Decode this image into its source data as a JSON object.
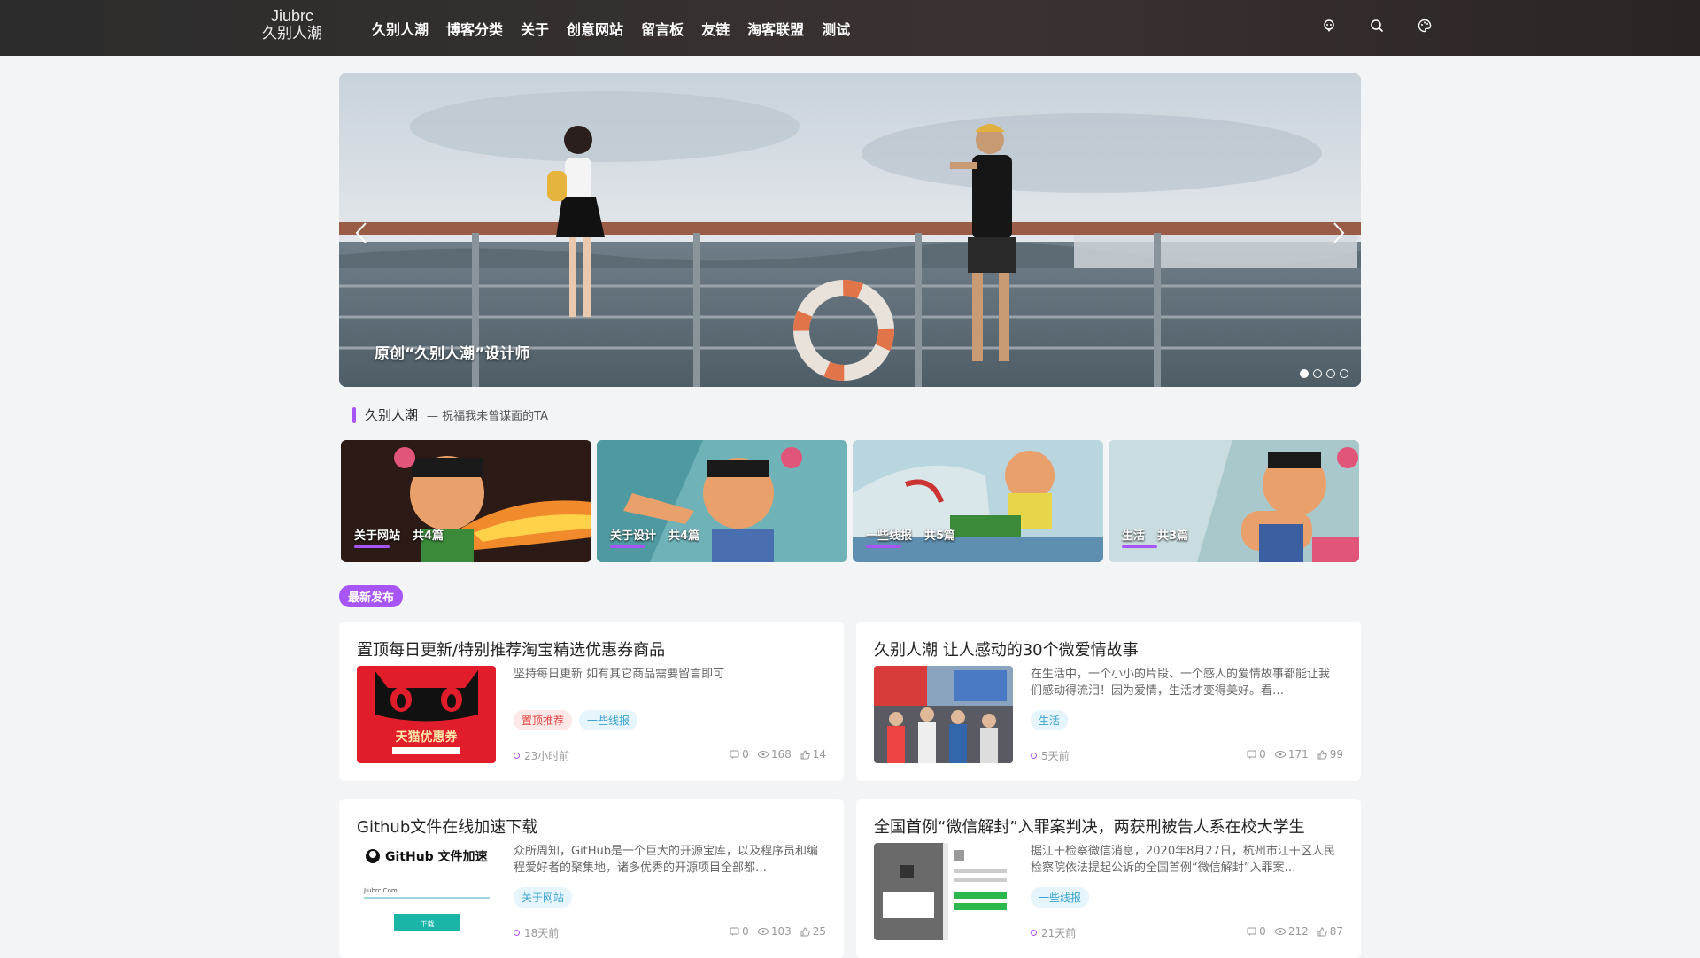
{
  "header": {
    "logo_en": "Jiubrc",
    "logo_cn": "久别人潮",
    "nav": [
      "久别人潮",
      "博客分类",
      "关于",
      "创意网站",
      "留言板",
      "友链",
      "淘客联盟",
      "测试"
    ],
    "icons": [
      "user-icon",
      "search-icon",
      "palette-icon"
    ]
  },
  "banner": {
    "caption": "原创“久别人潮”设计师",
    "slides": 4,
    "active_slide": 1
  },
  "section": {
    "title": "久别人潮",
    "subtitle": "— 祝福我未曾谋面的TA"
  },
  "categories": [
    {
      "name": "关于网站",
      "count": "共4篇"
    },
    {
      "name": "关于设计",
      "count": "共4篇"
    },
    {
      "name": "一些线报",
      "count": "共5篇"
    },
    {
      "name": "生活",
      "count": "共3篇"
    }
  ],
  "latest_badge": "最新发布",
  "posts": [
    {
      "title": "置顶每日更新/特别推荐淘宝精选优惠券商品",
      "desc": "坚持每日更新 如有其它商品需要留言即可",
      "tags": [
        {
          "text": "置顶推荐",
          "style": "red"
        },
        {
          "text": "一些线报",
          "style": "blue"
        }
      ],
      "time": "23小时前",
      "comments": "0",
      "views": "168",
      "likes": "14",
      "thumb_text": "天猫优惠券"
    },
    {
      "title": "久别人潮 让人感动的30个微爱情故事",
      "desc": "在生活中，一个小小的片段、一个感人的爱情故事都能让我们感动得流泪！因为爱情，生活才变得美好。看…",
      "tags": [
        {
          "text": "生活",
          "style": "blue"
        }
      ],
      "time": "5天前",
      "comments": "0",
      "views": "171",
      "likes": "99"
    },
    {
      "title": "Github文件在线加速下载",
      "desc": "众所周知，GitHub是一个巨大的开源宝库，以及程序员和编程爱好者的聚集地，诸多优秀的开源项目全部都…",
      "tags": [
        {
          "text": "关于网站",
          "style": "blue"
        }
      ],
      "time": "18天前",
      "comments": "0",
      "views": "103",
      "likes": "25",
      "thumb_title": "GitHub 文件加速",
      "thumb_url": "Jiubrc.Com",
      "thumb_btn": "下载"
    },
    {
      "title": "全国首例“微信解封”入罪案判决，两获刑被告人系在校大学生",
      "desc": "据江干检察微信消息，2020年8月27日，杭州市江干区人民检察院依法提起公诉的全国首例“微信解封”入罪案…",
      "tags": [
        {
          "text": "一些线报",
          "style": "blue"
        }
      ],
      "time": "21天前",
      "comments": "0",
      "views": "212",
      "likes": "87"
    }
  ],
  "colors": {
    "accent": "#a855f7",
    "header_bg": "#2f2a28",
    "page_bg": "#f3f4f6"
  }
}
